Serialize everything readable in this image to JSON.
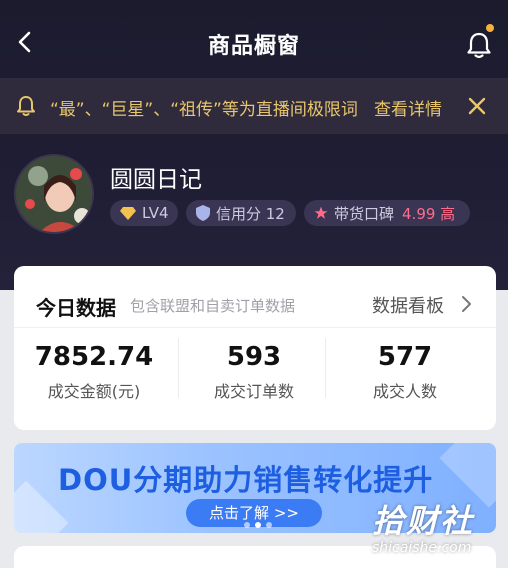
{
  "header": {
    "title": "商品橱窗"
  },
  "notice": {
    "text": "“最”、“巨星”、“祖传”等为直播间极限词",
    "link": "查看详情"
  },
  "profile": {
    "name": "圆圆日记",
    "level": "LV4",
    "credit": "信用分 12",
    "reputation_label": "带货口碑",
    "reputation_score": "4.99 高"
  },
  "stats_card": {
    "title": "今日数据",
    "subtitle": "包含联盟和自卖订单数据",
    "link": "数据看板",
    "items": [
      {
        "value": "7852.74",
        "label": "成交金额(元)"
      },
      {
        "value": "593",
        "label": "成交订单数"
      },
      {
        "value": "577",
        "label": "成交人数"
      }
    ]
  },
  "banner": {
    "title": "DOU分期助力销售转化提升",
    "button": "点击了解 >>"
  },
  "watermark": {
    "main": "拾财社",
    "sub": "shicaishe.com"
  },
  "colors": {
    "notice_text": "#e8c66b",
    "reputation": "#ff6b8a",
    "banner_title": "#1d5fe0",
    "banner_button": "#3b7cf5"
  }
}
